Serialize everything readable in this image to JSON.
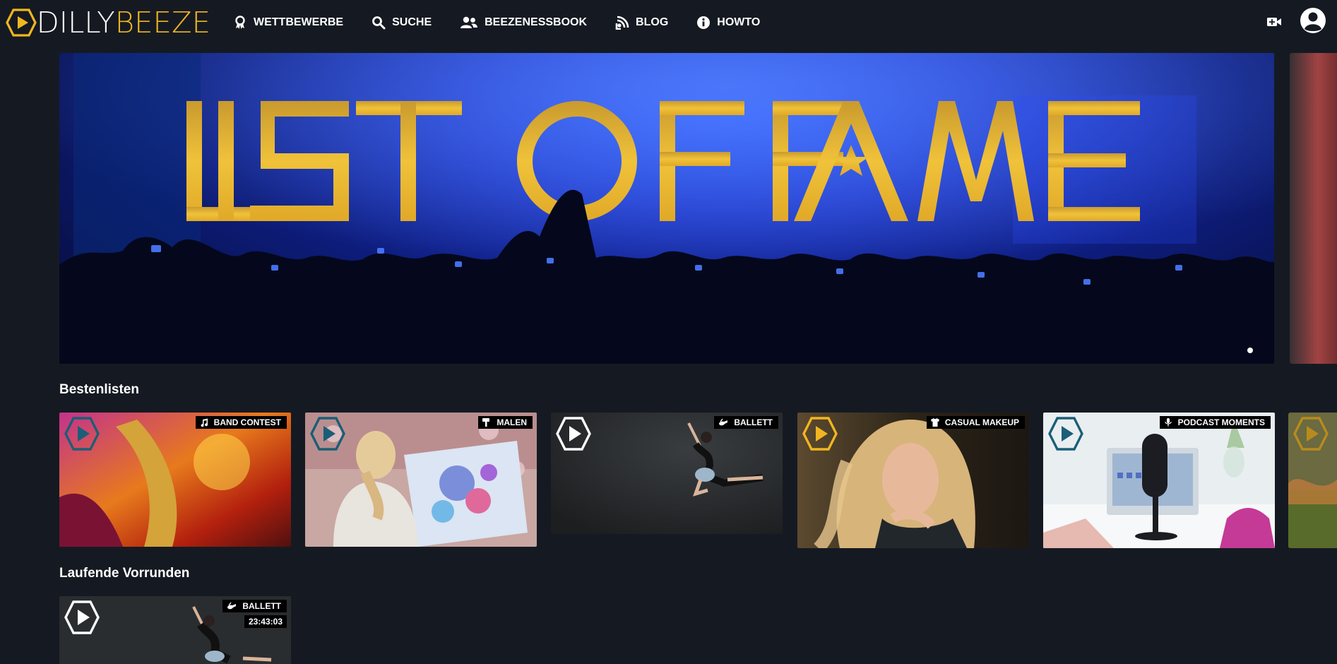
{
  "brand": {
    "part1": "DILLY",
    "part2": "BEEZE",
    "accent": "#f1b620"
  },
  "nav": [
    {
      "label": "WETTBEWERBE",
      "icon": "award-icon"
    },
    {
      "label": "SUCHE",
      "icon": "search-icon"
    },
    {
      "label": "BEEZENESSBOOK",
      "icon": "users-icon"
    },
    {
      "label": "BLOG",
      "icon": "podcast-icon"
    },
    {
      "label": "HOWTO",
      "icon": "info-icon"
    }
  ],
  "header_icons": [
    "video-plus-icon",
    "user-circle-icon"
  ],
  "hero": {
    "title": "LIST OF FAME",
    "slide_index": 1,
    "slide_count": 1
  },
  "sections": {
    "bestenlisten": {
      "title": "Bestenlisten",
      "cards": [
        {
          "category": "BAND CONTEST",
          "icon": "music-icon",
          "play_color": "#1b5e77"
        },
        {
          "category": "MALEN",
          "icon": "paint-roller-icon",
          "play_color": "#1b5e77"
        },
        {
          "category": "BALLETT",
          "icon": "ballet-shoe-icon",
          "play_color": "#ffffff"
        },
        {
          "category": "CASUAL MAKEUP",
          "icon": "tshirt-icon",
          "play_color": "#f1b620"
        },
        {
          "category": "PODCAST MOMENTS",
          "icon": "microphone-icon",
          "play_color": "#1b5e77"
        }
      ]
    },
    "vorrunden": {
      "title": "Laufende Vorrunden",
      "cards": [
        {
          "category": "BALLETT",
          "icon": "ballet-shoe-icon",
          "timer": "23:43:03",
          "play_color": "#ffffff"
        }
      ]
    }
  }
}
